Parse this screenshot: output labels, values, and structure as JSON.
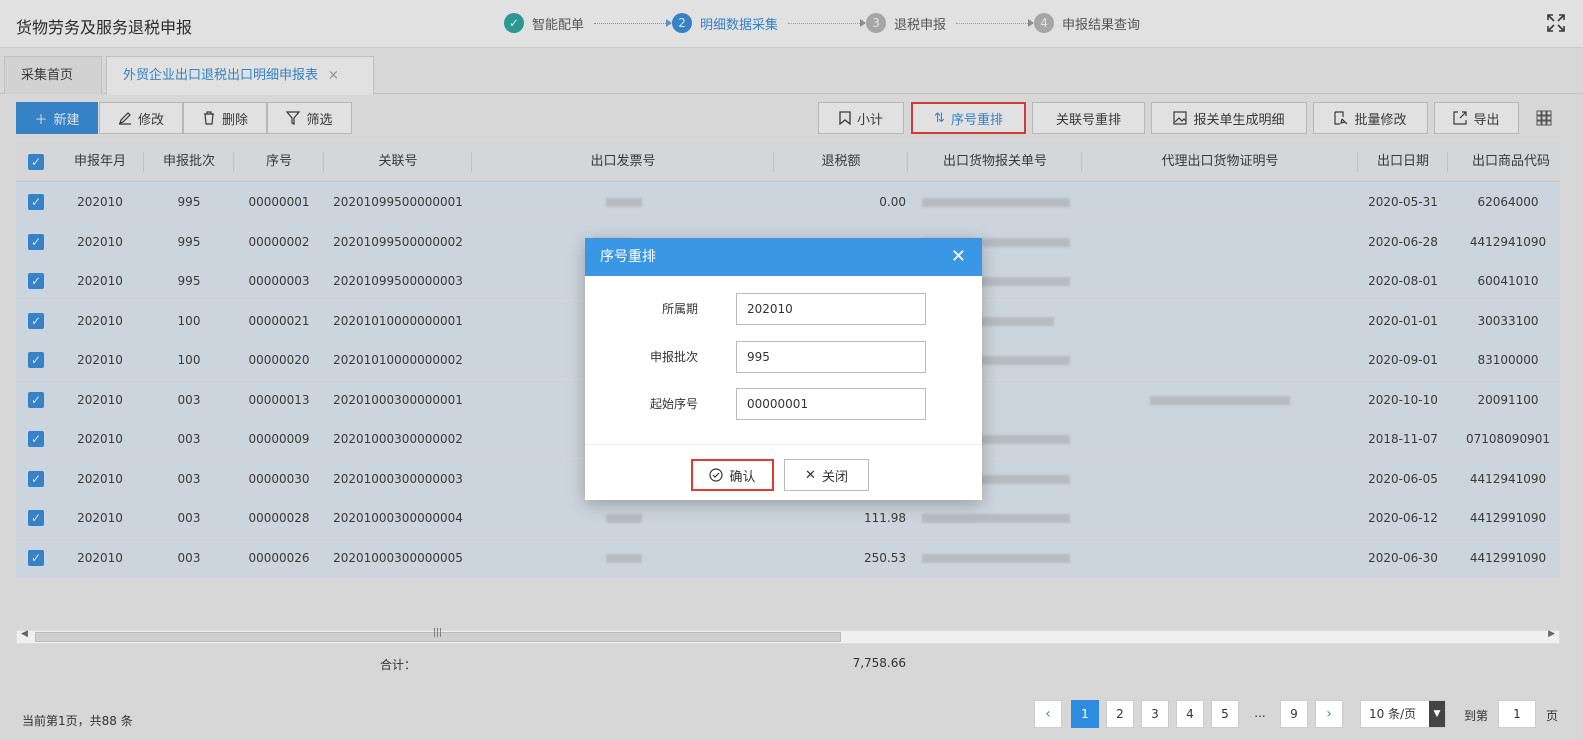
{
  "header": {
    "title": "货物劳务及服务退税申报",
    "steps": [
      {
        "num": "✓",
        "label": "智能配单"
      },
      {
        "num": "2",
        "label": "明细数据采集"
      },
      {
        "num": "3",
        "label": "退税申报"
      },
      {
        "num": "4",
        "label": "申报结果查询"
      }
    ]
  },
  "tabs": [
    {
      "label": "采集首页"
    },
    {
      "label": "外贸企业出口退税出口明细申报表",
      "close": "×"
    }
  ],
  "toolbar": {
    "new": "新建",
    "edit": "修改",
    "delete": "删除",
    "filter": "筛选",
    "subtotal": "小计",
    "renumber": "序号重排",
    "relnum_renumber": "关联号重排",
    "gen_detail": "报关单生成明细",
    "batch_edit": "批量修改",
    "export": "导出"
  },
  "columns": [
    "申报年月",
    "申报批次",
    "序号",
    "关联号",
    "出口发票号",
    "退税额",
    "出口货物报关单号",
    "代理出口货物证明号",
    "出口日期",
    "出口商品代码"
  ],
  "rows": [
    {
      "ym": "202010",
      "batch": "995",
      "seq": "00000001",
      "rel": "20201099500000001",
      "refund": "0.00",
      "date": "2020-05-31",
      "code": "62064000"
    },
    {
      "ym": "202010",
      "batch": "995",
      "seq": "00000002",
      "rel": "20201099500000002",
      "refund": "",
      "date": "2020-06-28",
      "code": "4412941090"
    },
    {
      "ym": "202010",
      "batch": "995",
      "seq": "00000003",
      "rel": "20201099500000003",
      "refund": "",
      "date": "2020-08-01",
      "code": "60041010"
    },
    {
      "ym": "202010",
      "batch": "100",
      "seq": "00000021",
      "rel": "20201010000000001",
      "refund": "",
      "date": "2020-01-01",
      "code": "30033100"
    },
    {
      "ym": "202010",
      "batch": "100",
      "seq": "00000020",
      "rel": "20201010000000002",
      "refund": "",
      "date": "2020-09-01",
      "code": "83100000"
    },
    {
      "ym": "202010",
      "batch": "003",
      "seq": "00000013",
      "rel": "20201000300000001",
      "refund": "",
      "date": "2020-10-10",
      "code": "20091100"
    },
    {
      "ym": "202010",
      "batch": "003",
      "seq": "00000009",
      "rel": "20201000300000002",
      "refund": "",
      "date": "2018-11-07",
      "code": "07108090901"
    },
    {
      "ym": "202010",
      "batch": "003",
      "seq": "00000030",
      "rel": "20201000300000003",
      "refund": "",
      "date": "2020-06-05",
      "code": "4412941090"
    },
    {
      "ym": "202010",
      "batch": "003",
      "seq": "00000028",
      "rel": "20201000300000004",
      "refund": "111.98",
      "date": "2020-06-12",
      "code": "4412991090"
    },
    {
      "ym": "202010",
      "batch": "003",
      "seq": "00000026",
      "rel": "20201000300000005",
      "refund": "250.53",
      "date": "2020-06-30",
      "code": "4412991090"
    }
  ],
  "summary": {
    "label": "合计：",
    "value": "7,758.66"
  },
  "pager": {
    "info": "当前第1页，共88 条",
    "pages": [
      "1",
      "2",
      "3",
      "4",
      "5",
      "...",
      "9"
    ],
    "prev": "‹",
    "next": "›",
    "page_size": "10 条/页",
    "goto_label": "到第",
    "goto_value": "1",
    "goto_unit": "页"
  },
  "modal": {
    "title": "序号重排",
    "fields": [
      {
        "label": "所属期",
        "value": "202010"
      },
      {
        "label": "申报批次",
        "value": "995"
      },
      {
        "label": "起始序号",
        "value": "00000001"
      }
    ],
    "confirm": "确认",
    "close": "关闭"
  },
  "colors": {
    "accent": "#2e8ce0",
    "highlight": "#e53935",
    "modal_header": "#3a97e6"
  }
}
